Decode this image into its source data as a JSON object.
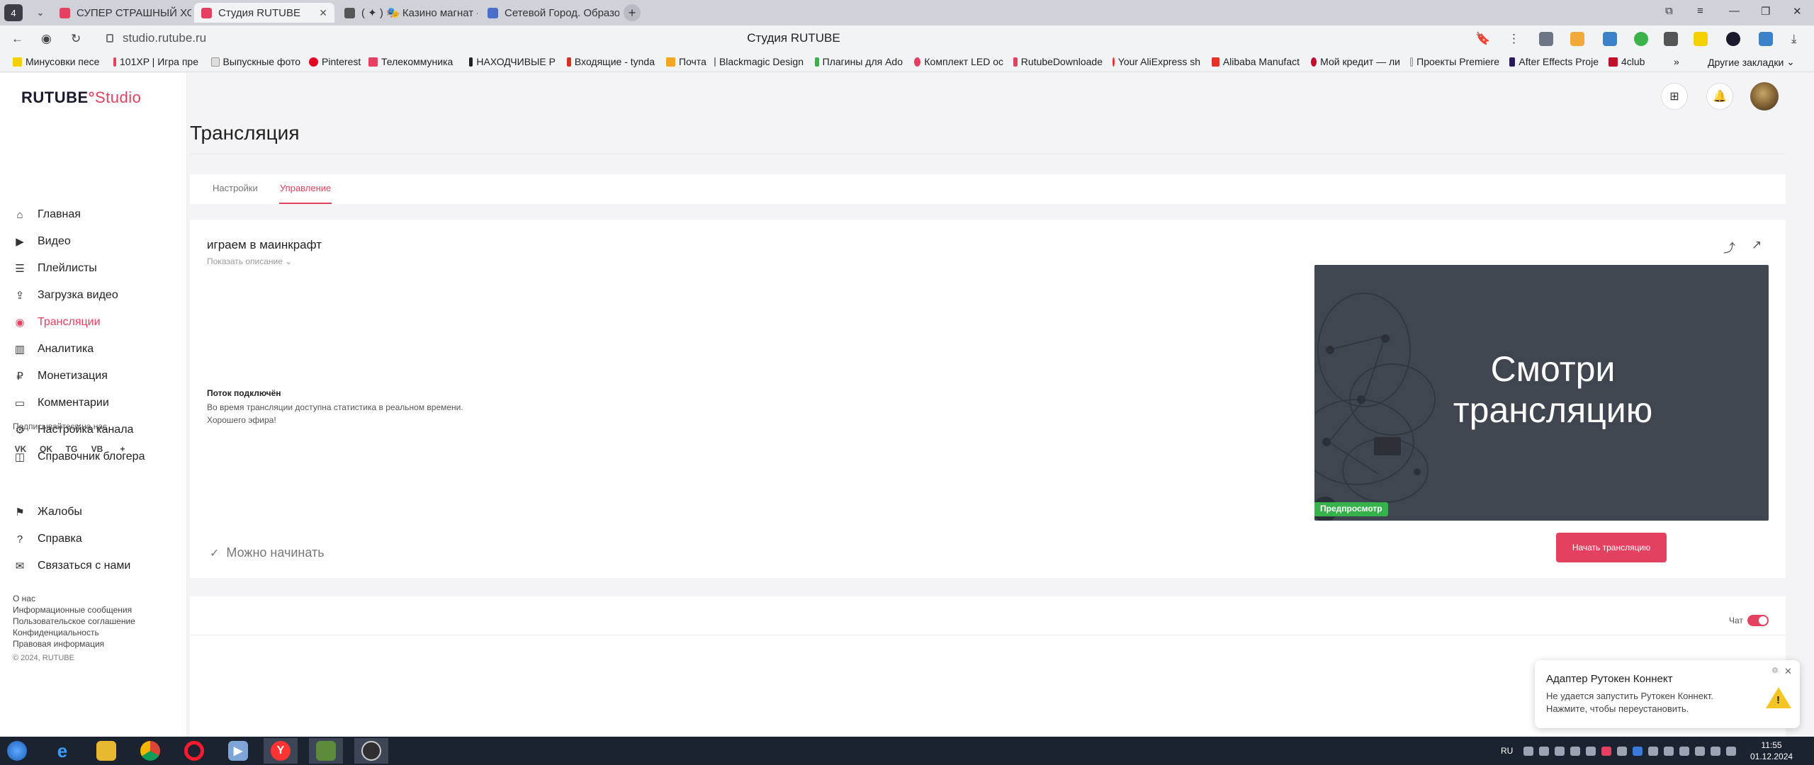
{
  "browser": {
    "tabs": [
      {
        "label": "СУПЕР СТРАШНЫЙ ХОР",
        "color": "#e4405f"
      },
      {
        "label": "Студия RUTUBE",
        "color": "#e4405f"
      },
      {
        "label": "( ✦ ) 🎭 Казино магнат - R",
        "color": "#333"
      },
      {
        "label": "Сетевой Город. Образова",
        "color": "#4a6fc9"
      }
    ],
    "url": "studio.rutube.ru",
    "page_title": "Студия RUTUBE",
    "bookmarks": [
      "Минусовки песе",
      "101XP | Игра пре",
      "Выпускные фото",
      "Pinterest",
      "Телекоммуника",
      "НАХОДЧИВЫЕ Р",
      "Входящие - tynda",
      "Почта",
      "Blackmagic Design",
      "Плагины для Ado",
      "Комплект LED ос",
      "RutubeDownloade",
      "Your AliExpress sh",
      "Alibaba Manufact",
      "Мой кредит — ли",
      "Проекты Premiere",
      "After Effects Proje",
      "4club"
    ],
    "bookmarks_more": "»",
    "other_bookmarks": "Другие закладки"
  },
  "app": {
    "logo_main": "RUTUBE",
    "logo_studio": "Studio",
    "nav": [
      {
        "label": "Главная",
        "icon": "home-icon"
      },
      {
        "label": "Видео",
        "icon": "video-icon"
      },
      {
        "label": "Плейлисты",
        "icon": "playlist-icon"
      },
      {
        "label": "Загрузка видео",
        "icon": "upload-icon"
      },
      {
        "label": "Трансляции",
        "icon": "broadcast-icon"
      },
      {
        "label": "Аналитика",
        "icon": "analytics-icon"
      },
      {
        "label": "Монетизация",
        "icon": "monetization-icon"
      },
      {
        "label": "Комментарии",
        "icon": "comments-icon"
      },
      {
        "label": "Настройка канала",
        "icon": "settings-icon"
      },
      {
        "label": "Справочник блогера",
        "icon": "handbook-icon"
      }
    ],
    "follow_us": "Подписывайтесь на нас",
    "social": [
      "VK",
      "OK",
      "TG",
      "VB",
      "+"
    ],
    "secondary_nav": [
      {
        "label": "Жалобы",
        "icon": "flag-icon"
      },
      {
        "label": "Справка",
        "icon": "help-icon"
      },
      {
        "label": "Связаться с нами",
        "icon": "mail-icon"
      }
    ],
    "footer_links": [
      "О нас",
      "Информационные сообщения",
      "Пользовательское соглашение",
      "Конфиденциальность",
      "Правовая информация"
    ],
    "copyright": "© 2024, RUTUBE"
  },
  "page": {
    "title": "Трансляция",
    "tabs": [
      "Настройки",
      "Управление"
    ],
    "active_tab": "Управление",
    "stream": {
      "title": "играем в маинкрафт",
      "show_description": "Показать описание",
      "status_heading": "Поток подключён",
      "status_line1": "Во время трансляции доступна статистика в реальном времени.",
      "status_line2": "Хорошего эфира!",
      "ready_text": "Можно начинать",
      "preview_line1": "Смотри",
      "preview_line2": "трансляцию",
      "preview_badge": "Предпросмотр",
      "start_button": "Начать трансляцию"
    },
    "chat_label": "Чат",
    "chat_enabled": true
  },
  "toast": {
    "title": "Адаптер Рутокен Коннект",
    "body": "Не удается запустить Рутокен Коннект. Нажмите, чтобы переустановить."
  },
  "taskbar": {
    "lang": "RU",
    "time": "11:55",
    "date": "01.12.2024"
  },
  "colors": {
    "accent": "#e4405f",
    "preview_bg": "#3f4650",
    "badge_green": "#36b24a"
  }
}
